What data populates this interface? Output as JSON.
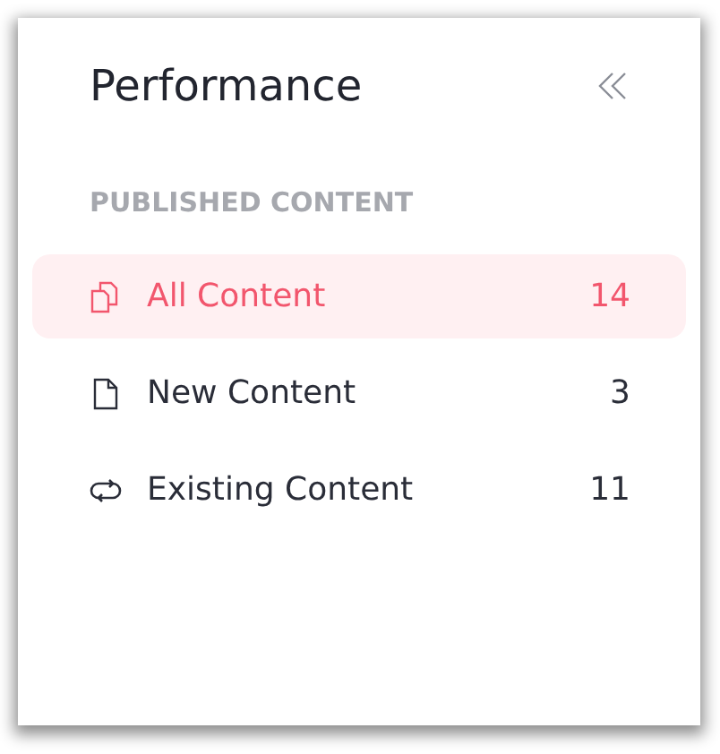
{
  "panel": {
    "title": "Performance",
    "section_label": "PUBLISHED CONTENT",
    "items": [
      {
        "kind": "copies",
        "label": "All Content",
        "count": "14",
        "selected": true
      },
      {
        "kind": "file",
        "label": "New Content",
        "count": "3",
        "selected": false
      },
      {
        "kind": "sync",
        "label": "Existing Content",
        "count": "11",
        "selected": false
      }
    ]
  }
}
